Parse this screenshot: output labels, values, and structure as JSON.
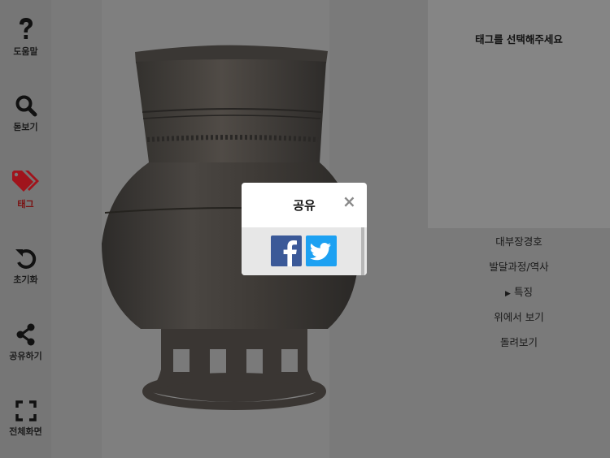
{
  "toolbar": {
    "items": [
      {
        "label": "도움말",
        "icon": "question-icon"
      },
      {
        "label": "돋보기",
        "icon": "search-icon"
      },
      {
        "label": "태그",
        "icon": "tag-icon",
        "active": true
      },
      {
        "label": "초기화",
        "icon": "reset-icon"
      },
      {
        "label": "공유하기",
        "icon": "share-icon"
      },
      {
        "label": "전체화면",
        "icon": "fullscreen-icon"
      }
    ]
  },
  "tag_panel": {
    "prompt": "태그를 선택해주세요"
  },
  "menu": {
    "items": [
      {
        "label": "대부장경호"
      },
      {
        "label": "발달과정/역사"
      },
      {
        "label": "특징",
        "marker": "▶"
      },
      {
        "label": "위에서 보기"
      },
      {
        "label": "돌려보기"
      }
    ]
  },
  "share_modal": {
    "title": "공유",
    "close": "×",
    "buttons": [
      {
        "name": "facebook",
        "icon": "facebook-icon",
        "color": "#3b5998"
      },
      {
        "name": "twitter",
        "icon": "twitter-icon",
        "color": "#1da1f2"
      }
    ]
  },
  "colors": {
    "accent_active": "#a0141c",
    "overlay": "#7a7a7a"
  }
}
